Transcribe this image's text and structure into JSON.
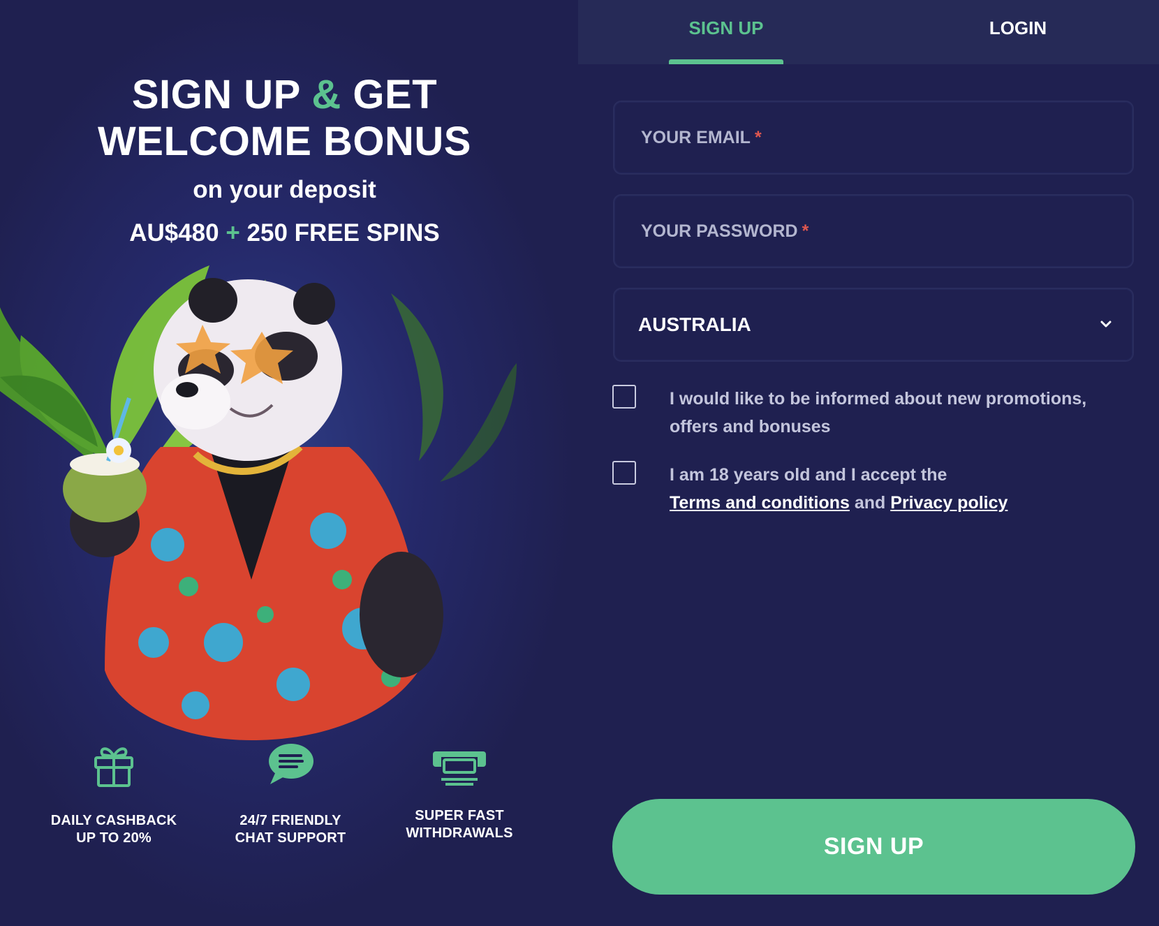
{
  "promo": {
    "title_part1": "SIGN UP",
    "title_amp": "&",
    "title_part2": "GET",
    "title_line2": "WELCOME BONUS",
    "subtitle": "on your deposit",
    "offer_amount": "AU$480",
    "offer_plus": "+",
    "offer_spins": "250 FREE SPINS",
    "mascot_icon": "panda-mascot-illustration"
  },
  "features": [
    {
      "icon": "gift-icon",
      "line1": "DAILY CASHBACK",
      "line2": "UP TO 20%"
    },
    {
      "icon": "chat-bubble-icon",
      "line1": "24/7 FRIENDLY",
      "line2": "CHAT SUPPORT"
    },
    {
      "icon": "withdrawal-icon",
      "line1": "SUPER FAST",
      "line2": "WITHDRAWALS"
    }
  ],
  "tabs": {
    "signup": "SIGN UP",
    "login": "LOGIN",
    "active": "signup"
  },
  "form": {
    "email_placeholder": "YOUR EMAIL",
    "password_placeholder": "YOUR PASSWORD",
    "required_marker": "*",
    "country_value": "AUSTRALIA",
    "promo_consent": "I would like to be informed about new promotions, offers and bonuses",
    "age_text_pre": "I am 18 years old and I accept the",
    "terms_link": "Terms and conditions",
    "and_text": "and",
    "privacy_link": "Privacy policy",
    "promo_checked": false,
    "age_checked": false,
    "submit_label": "SIGN UP"
  },
  "colors": {
    "accent": "#5cc28f",
    "background": "#1f2050",
    "tab_bar": "#262a57",
    "required": "#e0574f"
  }
}
